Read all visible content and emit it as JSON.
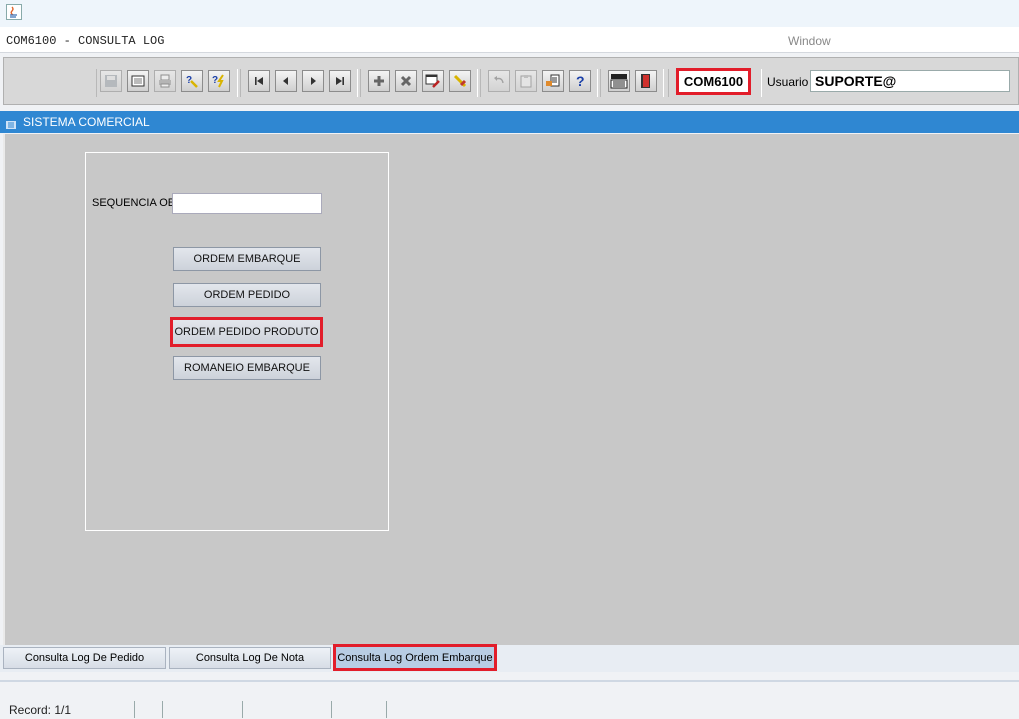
{
  "window": {
    "menu_item": "COM6100 - CONSULTA LOG",
    "window_menu": "Window"
  },
  "toolbar": {
    "form_code": "COM6100",
    "usuario_label": "Usuario",
    "usuario_value": "SUPORTE@",
    "buttons": [
      {
        "name": "save-icon"
      },
      {
        "name": "window-icon"
      },
      {
        "name": "print-icon"
      },
      {
        "name": "query-help-icon"
      },
      {
        "name": "execute-query-icon"
      },
      {
        "name": "first-record-icon"
      },
      {
        "name": "previous-record-icon"
      },
      {
        "name": "next-record-icon"
      },
      {
        "name": "last-record-icon"
      },
      {
        "name": "insert-record-icon"
      },
      {
        "name": "delete-record-icon"
      },
      {
        "name": "edit-icon"
      },
      {
        "name": "clear-icon"
      },
      {
        "name": "undo-icon"
      },
      {
        "name": "clipboard-icon"
      },
      {
        "name": "hand-list-icon"
      },
      {
        "name": "help-icon"
      },
      {
        "name": "menu-icon"
      },
      {
        "name": "exit-icon"
      }
    ]
  },
  "title_bar": {
    "text": "SISTEMA COMERCIAL"
  },
  "form": {
    "sequencia_label": "SEQUENCIA OE",
    "sequencia_value": "",
    "buttons": {
      "ordem_embarque": "ORDEM EMBARQUE",
      "ordem_pedido": "ORDEM PEDIDO",
      "ordem_pedido_produto": "ORDEM PEDIDO PRODUTO",
      "romaneio_embarque": "ROMANEIO EMBARQUE"
    }
  },
  "tabs": [
    {
      "label": "Consulta Log De Pedido",
      "active": false
    },
    {
      "label": "Consulta Log De Nota",
      "active": false
    },
    {
      "label": "Consulta Log Ordem Embarque",
      "active": true
    }
  ],
  "status": {
    "record": "Record: 1/1"
  },
  "colors": {
    "highlight": "#e21d2a",
    "title_bar": "#2f87d2",
    "canvas": "#c8c8c8"
  }
}
